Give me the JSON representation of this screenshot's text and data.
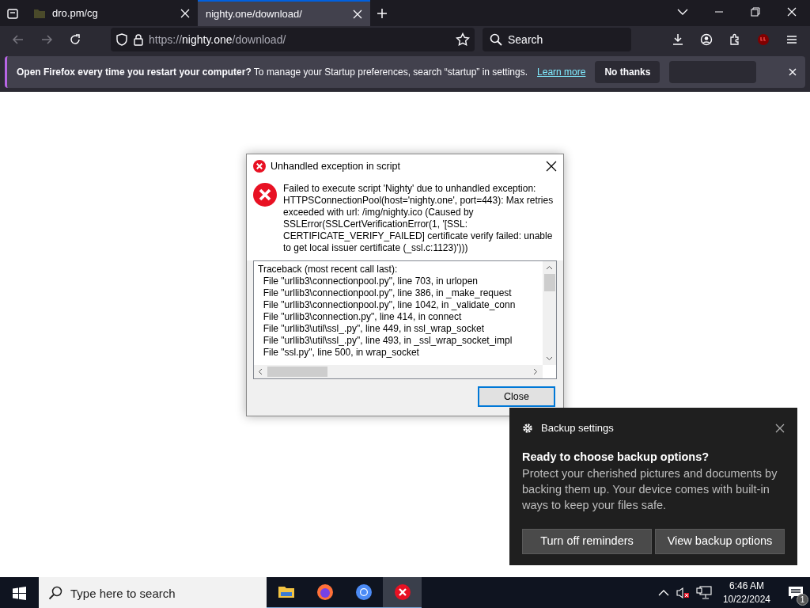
{
  "browser": {
    "tabs": [
      {
        "label": "dro.pm/cg",
        "selected": false
      },
      {
        "label": "nighty.one/download/",
        "selected": true
      }
    ],
    "url": {
      "scheme": "https://",
      "host": "nighty.one",
      "path": "/download/"
    },
    "search": {
      "placeholder": "Search"
    },
    "infobar": {
      "message": "**Open Firefox every time you restart your computer?** To manage your Startup preferences, search “startup” in settings.",
      "link": "Learn more",
      "buttons": [
        {
          "kind": "text",
          "label": "No thanks"
        },
        {
          "kind": "blank"
        }
      ]
    }
  },
  "dialog": {
    "title": "Unhandled exception in script",
    "message": "Failed to execute script 'Nighty' due to unhandled exception: HTTPSConnectionPool(host='nighty.one', port=443): Max retries exceeded with url: /img/nighty.ico (Caused by SSLError(SSLCertVerificationError(1, '[SSL: CERTIFICATE_VERIFY_FAILED] certificate verify failed: unable to get local issuer certificate (_ssl.c:1123)')))",
    "traceback": [
      "Traceback (most recent call last):",
      "  File \"urllib3\\connectionpool.py\", line 703, in urlopen",
      "  File \"urllib3\\connectionpool.py\", line 386, in _make_request",
      "  File \"urllib3\\connectionpool.py\", line 1042, in _validate_conn",
      "  File \"urllib3\\connection.py\", line 414, in connect",
      "  File \"urllib3\\util\\ssl_.py\", line 449, in ssl_wrap_socket",
      "  File \"urllib3\\util\\ssl_.py\", line 493, in _ssl_wrap_socket_impl",
      "  File \"ssl.py\", line 500, in wrap_socket"
    ],
    "button": "Close"
  },
  "toast": {
    "app": "Backup settings",
    "heading": "Ready to choose backup options?",
    "body": "Protect your cherished pictures and documents by backing them up. Your device comes with built-in ways to keep your files safe.",
    "buttons": [
      "Turn off reminders",
      "View backup options"
    ]
  },
  "taskbar": {
    "search": {
      "placeholder": "Type here to search"
    },
    "apps": [
      {
        "kind": "folder",
        "selected": false
      },
      {
        "kind": "firefox",
        "selected": false
      },
      {
        "kind": "chromium",
        "selected": false
      },
      {
        "kind": "error",
        "selected": true
      }
    ],
    "time": "6:46 AM",
    "date": "10/22/2024",
    "notifications": "1"
  }
}
